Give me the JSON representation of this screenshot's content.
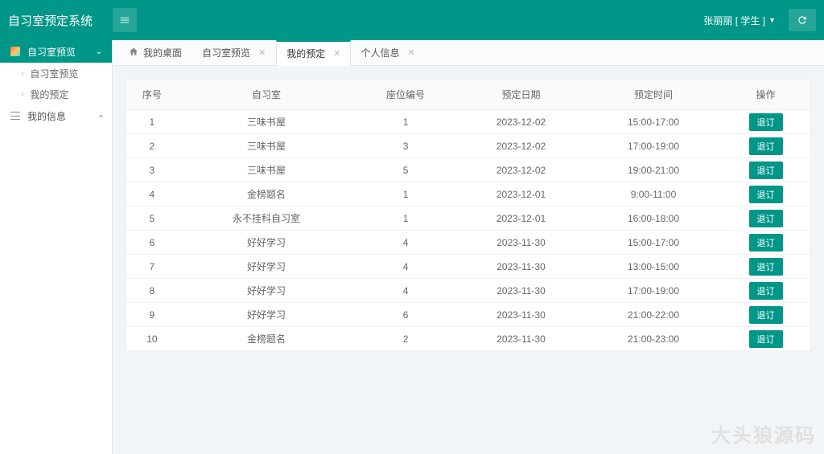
{
  "header": {
    "title": "自习室预定系统",
    "user_label": "张丽丽 [ 学生 ]"
  },
  "sidebar": {
    "group1_label": "自习室预览",
    "sub1_label": "自习室预览",
    "sub2_label": "我的预定",
    "group2_label": "我的信息"
  },
  "tabs": {
    "home_label": "我的桌面",
    "t1_label": "自习室预览",
    "t2_label": "我的预定",
    "t3_label": "个人信息"
  },
  "table": {
    "headers": {
      "c1": "序号",
      "c2": "自习室",
      "c3": "座位编号",
      "c4": "预定日期",
      "c5": "预定时间",
      "c6": "操作"
    },
    "rows": [
      {
        "idx": "1",
        "room": "三味书屋",
        "seat": "1",
        "date": "2023-12-02",
        "time": "15:00-17:00"
      },
      {
        "idx": "2",
        "room": "三味书屋",
        "seat": "3",
        "date": "2023-12-02",
        "time": "17:00-19:00"
      },
      {
        "idx": "3",
        "room": "三味书屋",
        "seat": "5",
        "date": "2023-12-02",
        "time": "19:00-21:00"
      },
      {
        "idx": "4",
        "room": "金榜题名",
        "seat": "1",
        "date": "2023-12-01",
        "time": "9:00-11:00"
      },
      {
        "idx": "5",
        "room": "永不挂科自习室",
        "seat": "1",
        "date": "2023-12-01",
        "time": "16:00-18:00"
      },
      {
        "idx": "6",
        "room": "好好学习",
        "seat": "4",
        "date": "2023-11-30",
        "time": "15:00-17:00"
      },
      {
        "idx": "7",
        "room": "好好学习",
        "seat": "4",
        "date": "2023-11-30",
        "time": "13:00-15:00"
      },
      {
        "idx": "8",
        "room": "好好学习",
        "seat": "4",
        "date": "2023-11-30",
        "time": "17:00-19:00"
      },
      {
        "idx": "9",
        "room": "好好学习",
        "seat": "6",
        "date": "2023-11-30",
        "time": "21:00-22:00"
      },
      {
        "idx": "10",
        "room": "金榜题名",
        "seat": "2",
        "date": "2023-11-30",
        "time": "21:00-23:00"
      }
    ],
    "action_label": "退订"
  },
  "watermark": "大头狼源码"
}
